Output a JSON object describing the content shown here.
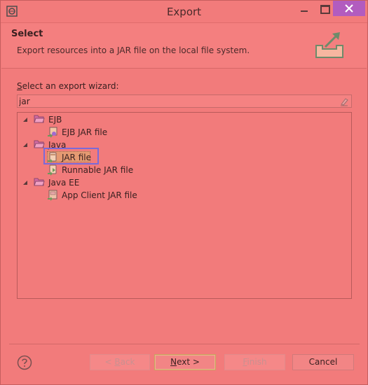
{
  "window": {
    "title": "Export"
  },
  "banner": {
    "title": "Select",
    "description": "Export resources into a JAR file on the local file system."
  },
  "wizard": {
    "label_first": "S",
    "label_rest": "elect an export wizard:",
    "filter_value": "jar"
  },
  "tree": {
    "nodes": [
      {
        "label": "EJB"
      },
      {
        "label": "EJB JAR file"
      },
      {
        "label": "Java"
      },
      {
        "label": "JAR file"
      },
      {
        "label": "Runnable JAR file"
      },
      {
        "label": "Java EE"
      },
      {
        "label": "App Client JAR file"
      }
    ]
  },
  "buttons": {
    "back_prefix": "< ",
    "back_mn": "B",
    "back_rest": "ack",
    "next_mn": "N",
    "next_rest": "ext >",
    "finish_mn": "F",
    "finish_rest": "inish",
    "cancel": "Cancel"
  },
  "colors": {
    "background": "#f27b7b",
    "close_button": "#b25cbf",
    "selection_border": "#7a6ad8"
  }
}
